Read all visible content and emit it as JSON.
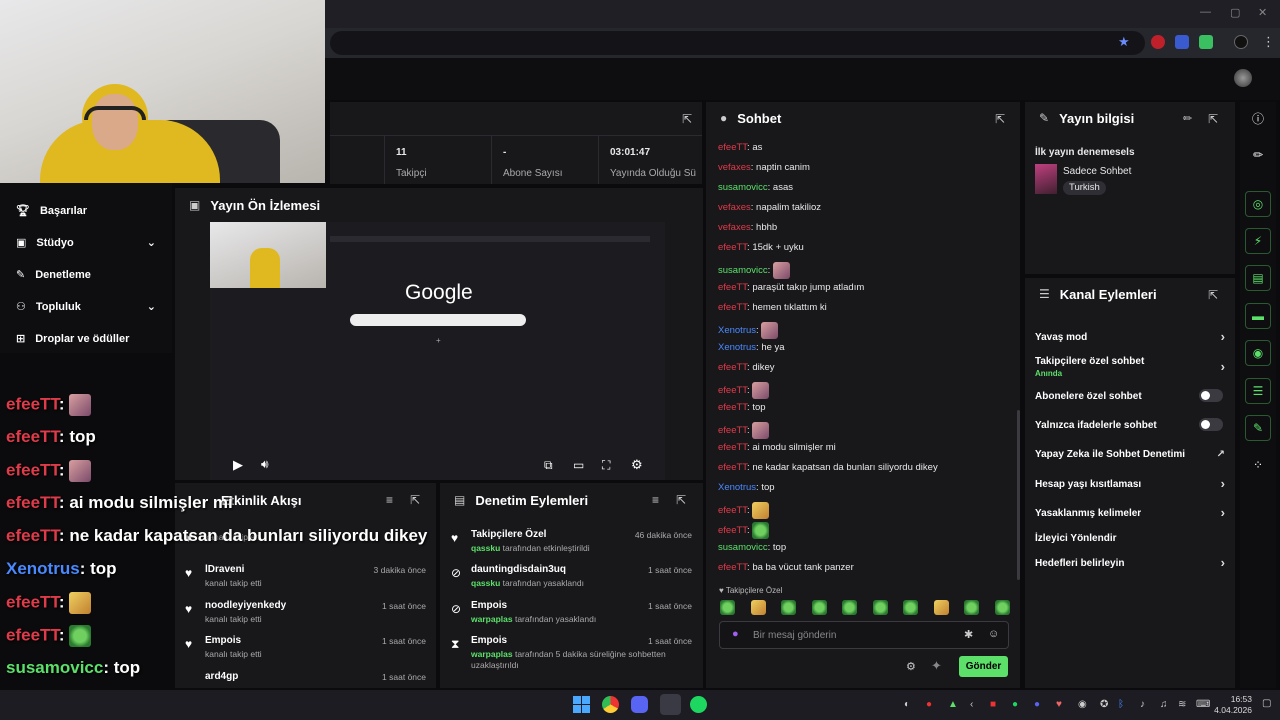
{
  "colors": {
    "accent": "#5ce06a",
    "username_red": "#e03b4a",
    "username_green": "#5ce06a",
    "username_blue": "#4a89ff",
    "panel": "#18181b"
  },
  "stats": [
    {
      "value": "11",
      "label": "Takipçi"
    },
    {
      "value": "-",
      "label": "Abone Sayısı"
    },
    {
      "value": "03:01:47",
      "label": "Yayında Olduğu Süre"
    }
  ],
  "nav": [
    {
      "label": "Başarılar",
      "icon": "trophy-icon",
      "expandable": false
    },
    {
      "label": "Stüdyo",
      "icon": "studio-icon",
      "expandable": true
    },
    {
      "label": "Denetleme",
      "icon": "wrench-icon",
      "expandable": false
    },
    {
      "label": "Topluluk",
      "icon": "community-icon",
      "expandable": true
    },
    {
      "label": "Droplar ve ödüller",
      "icon": "gift-icon",
      "expandable": false
    }
  ],
  "overlay_chat": [
    {
      "user": "efeeTT",
      "color": "red",
      "text": "",
      "emote": "face"
    },
    {
      "user": "efeeTT",
      "color": "red",
      "text": "top",
      "emote": ""
    },
    {
      "user": "efeeTT",
      "color": "red",
      "text": "",
      "emote": "face"
    },
    {
      "user": "efeeTT",
      "color": "red",
      "text": "ai modu silmişler mi",
      "emote": ""
    },
    {
      "user": "efeeTT",
      "color": "red",
      "text": "ne kadar kapatsan da bunları siliyordu dikey",
      "emote": ""
    },
    {
      "user": "Xenotrus",
      "color": "blue",
      "text": "top",
      "emote": ""
    },
    {
      "user": "efeeTT",
      "color": "red",
      "text": "",
      "emote": "yellow"
    },
    {
      "user": "efeeTT",
      "color": "red",
      "text": "",
      "emote": "frog"
    },
    {
      "user": "susamovicc",
      "color": "green",
      "text": "top",
      "emote": ""
    },
    {
      "user": "efeeTT",
      "color": "red",
      "text": "ba ba vücut tank panzer",
      "emote": ""
    }
  ],
  "preview": {
    "title": "Yayın Ön İzlemesi",
    "google_logo": "Google"
  },
  "activity": {
    "title": "Etkinlik Akışı",
    "items": [
      {
        "name": "",
        "sub": "kanalı takip etti",
        "time": ""
      },
      {
        "name": "lDraveni",
        "sub": "kanalı takip etti",
        "time": "3 dakika önce"
      },
      {
        "name": "noodleyiyenkedy",
        "sub": "kanalı takip etti",
        "time": "1 saat önce"
      },
      {
        "name": "Empois",
        "sub": "kanalı takip etti",
        "time": "1 saat önce"
      },
      {
        "name": "ard4gp",
        "sub": "",
        "time": "1 saat önce"
      }
    ]
  },
  "moderation": {
    "title": "Denetim Eylemleri",
    "items": [
      {
        "name": "Takipçilere Özel",
        "actor": "qassku",
        "action": "tarafından etkinleştirildi",
        "time": "46 dakika önce",
        "icon": "heart-icon"
      },
      {
        "name": "dauntingdisdain3uq",
        "actor": "qassku",
        "action": "tarafından yasaklandı",
        "time": "1 saat önce",
        "icon": "ban-icon"
      },
      {
        "name": "Empois",
        "actor": "warpaplas",
        "action": "tarafından yasaklandı",
        "time": "1 saat önce",
        "icon": "ban-icon"
      },
      {
        "name": "Empois",
        "actor": "warpaplas",
        "action": "tarafından 5 dakika süreliğine sohbetten uzaklaştırıldı",
        "time": "1 saat önce",
        "icon": "hourglass-icon"
      }
    ]
  },
  "chat": {
    "title": "Sohbet",
    "messages": [
      {
        "user": "efeeTT",
        "color": "red",
        "text": "as",
        "emote": ""
      },
      {
        "user": "vefaxes",
        "color": "red",
        "text": "naptin canim",
        "emote": ""
      },
      {
        "user": "susamovicc",
        "color": "green",
        "text": "asas",
        "emote": ""
      },
      {
        "user": "vefaxes",
        "color": "red",
        "text": "napalim takilioz",
        "emote": ""
      },
      {
        "user": "vefaxes",
        "color": "red",
        "text": "hbhb",
        "emote": ""
      },
      {
        "user": "efeeTT",
        "color": "red",
        "text": "15dk + uyku",
        "emote": ""
      },
      {
        "user": "susamovicc",
        "color": "green",
        "text": "",
        "emote": "face"
      },
      {
        "user": "efeeTT",
        "color": "red",
        "text": "paraşüt takıp jump atladım",
        "emote": ""
      },
      {
        "user": "efeeTT",
        "color": "red",
        "text": "hemen tıklattım ki",
        "emote": ""
      },
      {
        "user": "Xenotrus",
        "color": "blue",
        "text": "",
        "emote": "face"
      },
      {
        "user": "Xenotrus",
        "color": "blue",
        "text": "he ya",
        "emote": ""
      },
      {
        "user": "efeeTT",
        "color": "red",
        "text": "dikey",
        "emote": ""
      },
      {
        "user": "efeeTT",
        "color": "red",
        "text": "",
        "emote": "face"
      },
      {
        "user": "efeeTT",
        "color": "red",
        "text": "top",
        "emote": ""
      },
      {
        "user": "efeeTT",
        "color": "red",
        "text": "",
        "emote": "face"
      },
      {
        "user": "efeeTT",
        "color": "red",
        "text": "ai modu silmişler mi",
        "emote": ""
      },
      {
        "user": "efeeTT",
        "color": "red",
        "text": "ne kadar kapatsan da bunları siliyordu dikey",
        "emote": ""
      },
      {
        "user": "Xenotrus",
        "color": "blue",
        "text": "top",
        "emote": ""
      },
      {
        "user": "efeeTT",
        "color": "red",
        "text": "",
        "emote": "yellow"
      },
      {
        "user": "efeeTT",
        "color": "red",
        "text": "",
        "emote": "frog"
      },
      {
        "user": "susamovicc",
        "color": "green",
        "text": "top",
        "emote": ""
      },
      {
        "user": "efeeTT",
        "color": "red",
        "text": "ba ba vücut tank panzer",
        "emote": ""
      }
    ],
    "followers_only": "Takipçilere Özel",
    "placeholder": "Bir mesaj gönderin",
    "send": "Gönder"
  },
  "stream_info": {
    "title": "Yayın bilgisi",
    "stream_title": "İlk yayın denemesels",
    "category": "Sadece Sohbet",
    "language": "Turkish"
  },
  "channel_actions": {
    "title": "Kanal Eylemleri",
    "items": [
      {
        "label": "Yavaş mod",
        "control": "arrow",
        "sub": ""
      },
      {
        "label": "Takipçilere özel sohbet",
        "control": "arrow",
        "sub": "Anında"
      },
      {
        "label": "Abonelere özel sohbet",
        "control": "toggle",
        "sub": ""
      },
      {
        "label": "Yalnızca ifadelerle sohbet",
        "control": "toggle",
        "sub": ""
      },
      {
        "label": "Yapay Zeka ile Sohbet Denetimi",
        "control": "external",
        "sub": ""
      },
      {
        "label": "Hesap yaşı kısıtlaması",
        "control": "arrow",
        "sub": ""
      },
      {
        "label": "Yasaklanmış kelimeler",
        "control": "arrow",
        "sub": ""
      },
      {
        "label": "İzleyici Yönlendir",
        "control": "none",
        "sub": ""
      },
      {
        "label": "Hedefleri belirleyin",
        "control": "arrow",
        "sub": ""
      }
    ]
  },
  "taskbar": {
    "time": "16:53",
    "date": "4.04.2026"
  }
}
